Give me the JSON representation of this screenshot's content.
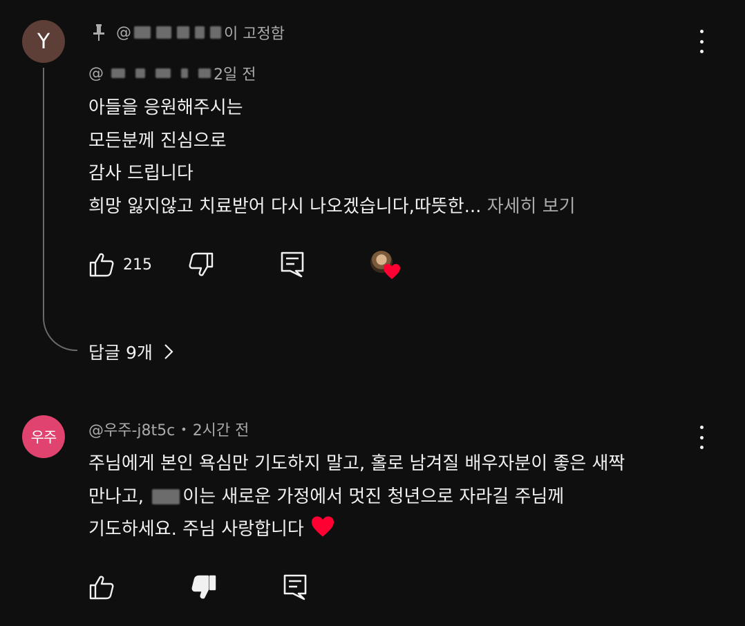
{
  "comments": [
    {
      "avatar_letter": "Y",
      "pinned_by_suffix": "이 고정함",
      "pinned_handle_prefix": "@",
      "handle_prefix": "@",
      "time": "2일 전",
      "lines": [
        "아들을 응원해주시는",
        "모든분께 진심으로",
        "감사 드립니다",
        "희망 잃지않고 치료받어 다시 나오겠습니다,따뜻한..."
      ],
      "read_more": "자세히 보기",
      "like_count": "215",
      "replies_label": "답글 9개"
    },
    {
      "avatar_letter": "우주",
      "handle": "@우주-j8t5c",
      "separator": "•",
      "time": "2시간 전",
      "line1": "주님에게 본인 욕심만 기도하지 말고, 홀로 남겨질 배우자분이 좋은 새짝",
      "line2_start": "만나고, ",
      "line2_end": "이는 새로운 가정에서 멋진 청년으로 자라길 주님께",
      "line3": "기도하세요. 주님 사랑합니다"
    }
  ],
  "colors": {
    "background": "#0f0f0f",
    "text": "#f1f1f1",
    "secondary_text": "#aaaaaa",
    "avatar_y": "#5d3f38",
    "avatar_u": "#e0436e",
    "heart": "#ff0033"
  },
  "icons": {
    "pin": "pin-icon",
    "like": "thumbs-up-icon",
    "dislike": "thumbs-down-icon",
    "reply": "reply-icon",
    "more": "more-vertical-icon",
    "chevron": "chevron-right-icon",
    "heart": "heart-icon"
  }
}
